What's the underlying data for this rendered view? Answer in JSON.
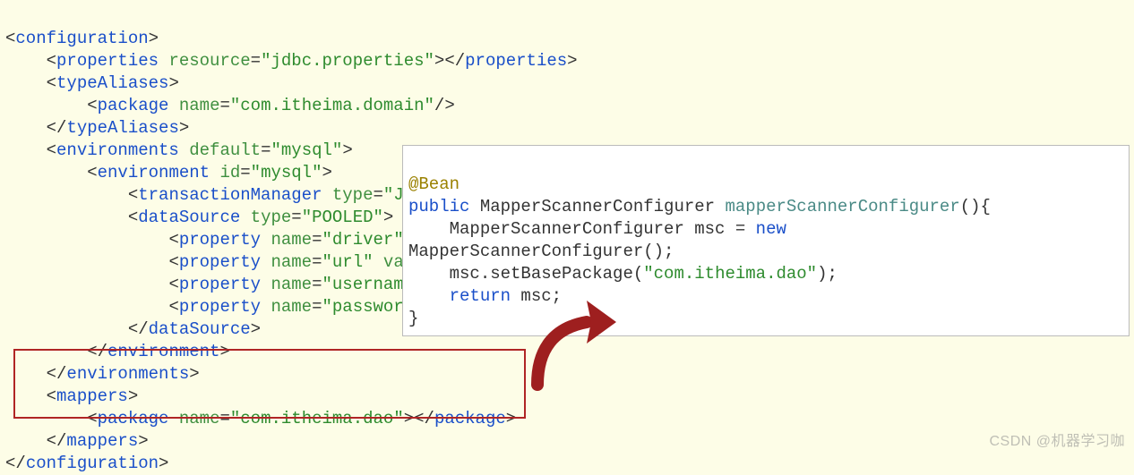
{
  "xml": {
    "root_open": "configuration",
    "properties": {
      "tag": "properties",
      "attr": "resource",
      "value": "jdbc.properties"
    },
    "typeAliases": {
      "tag": "typeAliases",
      "pkg": {
        "tag": "package",
        "attr": "name",
        "value": "com.itheima.domain"
      }
    },
    "environments": {
      "tag": "environments",
      "attr": "default",
      "value": "mysql",
      "environment": {
        "tag": "environment",
        "attr": "id",
        "value": "mysql",
        "transactionManager": {
          "tag": "transactionManager",
          "attr": "type",
          "cutval": "J"
        },
        "dataSource": {
          "tag": "dataSource",
          "attr": "type",
          "value": "POOLED",
          "props": [
            {
              "tag": "property",
              "attr": "name",
              "cutval": "driver"
            },
            {
              "tag": "property",
              "attr": "name",
              "cutval": "url",
              "extra_attr": "va"
            },
            {
              "tag": "property",
              "attr": "name",
              "cutval": "usernam"
            },
            {
              "tag": "property",
              "attr": "name",
              "cutval": "passwor"
            }
          ]
        }
      }
    },
    "mappers": {
      "tag": "mappers",
      "pkg": {
        "tag": "package",
        "attr": "name",
        "value": "com.itheima.dao"
      }
    }
  },
  "java": {
    "annotation": "@Bean",
    "public": "public",
    "class": "MapperScannerConfigurer",
    "method": "mapperScannerConfigurer",
    "line2_a": "MapperScannerConfigurer msc = ",
    "new": "new",
    "line2_b": "MapperScannerConfigurer();",
    "line3_a": "msc.setBasePackage(",
    "string": "\"com.itheima.dao\"",
    "line3_b": ");",
    "return": "return",
    "line4": " msc;",
    "brace": "}"
  },
  "colors": {
    "bg": "#fdfde7",
    "tag": "#1a4fc9",
    "attr": "#3f8f3f",
    "string": "#2e8b2e",
    "annotation": "#9a8100",
    "box": "#b02525",
    "arrow": "#a32020"
  },
  "watermark": "CSDN @机器学习咖"
}
